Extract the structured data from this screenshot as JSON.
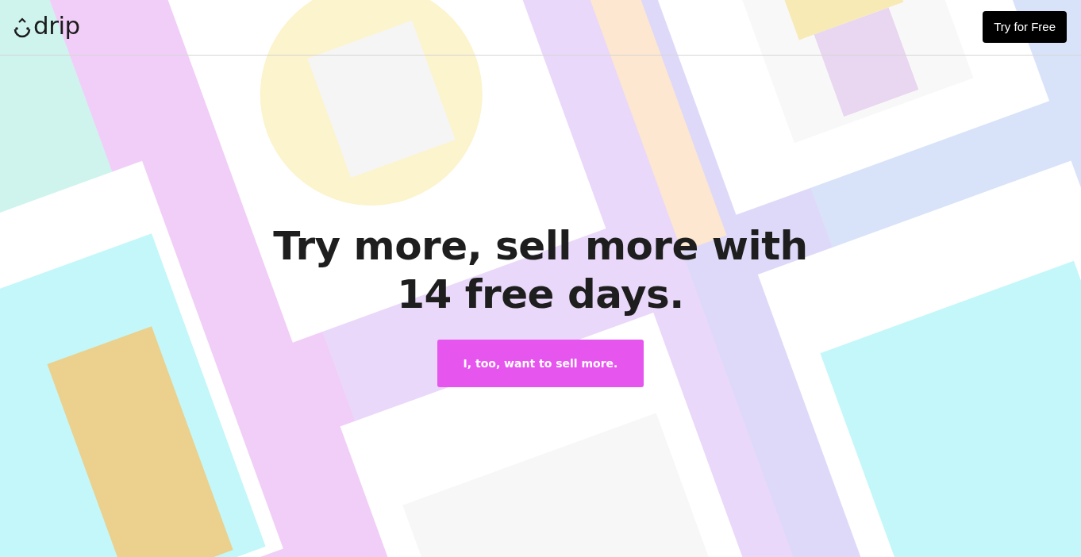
{
  "header": {
    "logo_text": "drip",
    "cta_button": "Try for Free"
  },
  "hero": {
    "headline_line_1": "Try more, sell more with",
    "headline_line_2": "14 free days.",
    "cta_button": "I, too, want to sell more."
  }
}
